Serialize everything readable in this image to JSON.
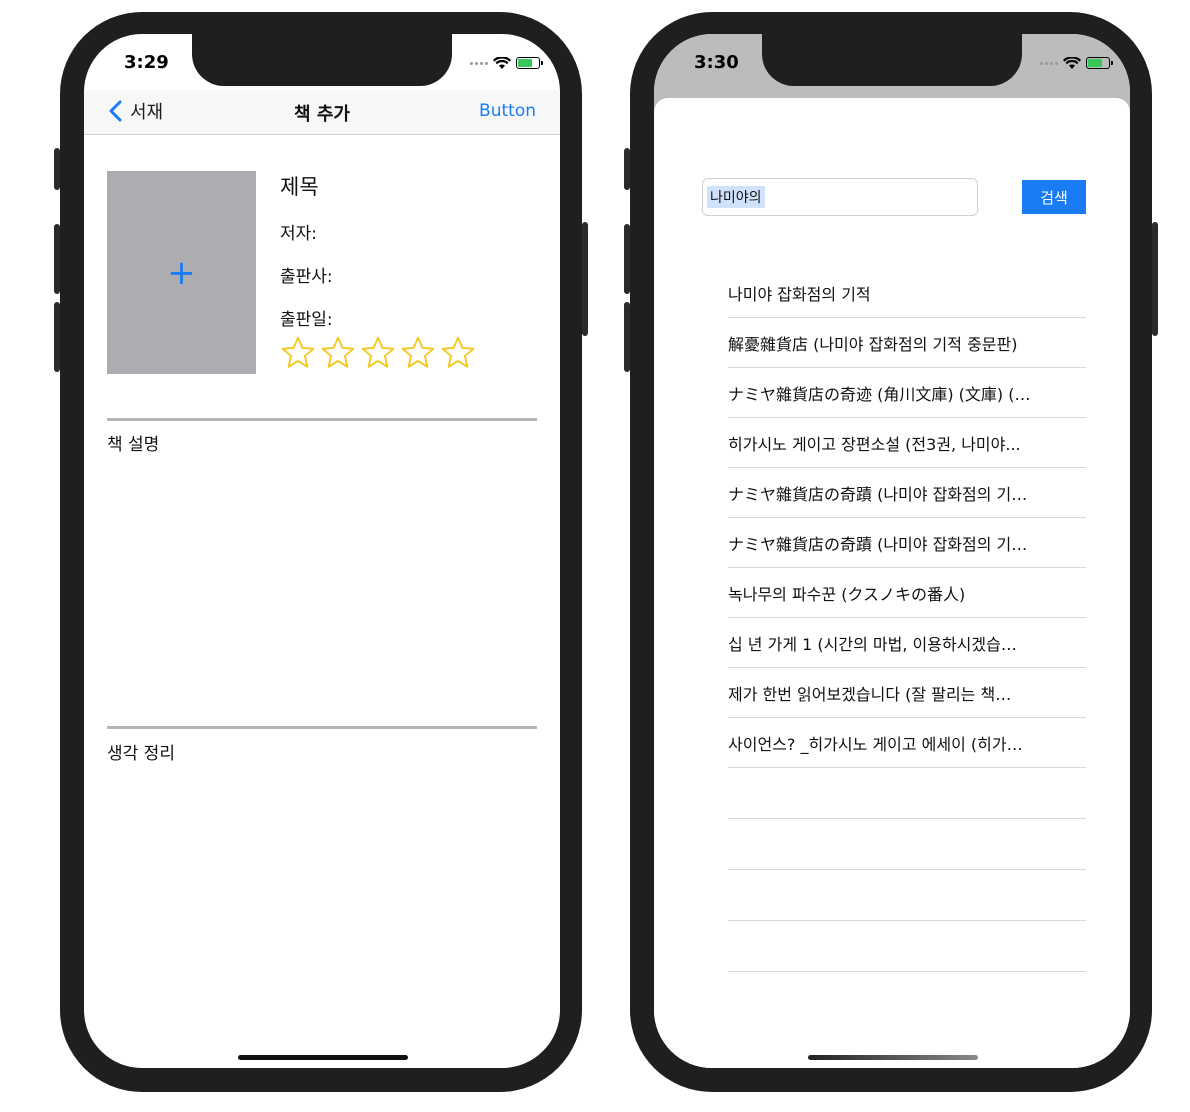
{
  "left_phone": {
    "status_time": "3:29",
    "nav": {
      "back_label": "서재",
      "title": "책 추가",
      "right_button": "Button"
    },
    "cover": {
      "add_symbol": "+"
    },
    "book_info": {
      "title": "제목",
      "author_label": "저자:",
      "publisher_label": "출판사:",
      "date_label": "출판일:"
    },
    "rating": {
      "stars_total": 5,
      "stars_filled": 0,
      "star_color": "#f5c518"
    },
    "sections": {
      "description": "책 설명",
      "thoughts": "생각 정리"
    }
  },
  "right_phone": {
    "status_time": "3:30",
    "search": {
      "value": "나미야의",
      "button_label": "검색"
    },
    "results": [
      "나미야 잡화점의 기적",
      "解憂雜貨店 (나미야 잡화점의 기적 중문판)",
      "ナミヤ雜貨店の奇迹 (角川文庫) (文庫) (…",
      "히가시노 게이고 장편소설 (전3권, 나미야...",
      "ナミヤ雜貨店の奇蹟 (나미야 잡화점의 기…",
      "ナミヤ雜貨店の奇蹟 (나미야 잡화점의 기…",
      "녹나무의 파수꾼 (クスノキの番人)",
      "십 년 가게 1 (시간의 마법, 이용하시겠습…",
      "제가 한번 읽어보겠습니다 (잘 팔리는 책…",
      "사이언스? _히가시노 게이고 에세이 (히가…"
    ]
  },
  "colors": {
    "accent": "#1a7cf5",
    "battery": "#35c759"
  }
}
